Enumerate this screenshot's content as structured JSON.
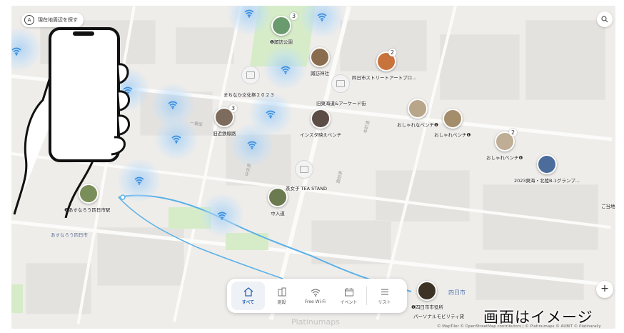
{
  "controls": {
    "locate_icon": "A",
    "locate_label": "現在地周辺を探す",
    "search_icon": "search-icon",
    "zoom_in": "+"
  },
  "pins": [
    {
      "label": "❶諏訪公園",
      "badge": "3",
      "color": "#6a9b6e"
    },
    {
      "label": "諏訪神社",
      "badge": "",
      "color": "#8a6d4f"
    },
    {
      "label": "四日市ストリートアートプロ...",
      "badge": "2",
      "color": "#c9733c"
    },
    {
      "label": "旧近鉄線路",
      "badge": "3",
      "color": "#7d6c5d"
    },
    {
      "label": "インスタ映えベンチ",
      "badge": "",
      "color": "#5b4d45"
    },
    {
      "label": "おしゃれなベンチ❶",
      "badge": "",
      "color": "#b8a58a"
    },
    {
      "label": "おしゃれベンチ❶",
      "badge": "",
      "color": "#a48d6b"
    },
    {
      "label": "おしゃれベンチ❹",
      "badge": "2",
      "color": "#bfae95"
    },
    {
      "label": "2023東海・北陸B-1グランプ...",
      "badge": "",
      "color": "#4c6d9b"
    },
    {
      "label": "中入道",
      "badge": "",
      "color": "#6b7a4f"
    },
    {
      "label": "❶あすなろう四日市駅",
      "badge": "",
      "color": "#7a8e5a"
    },
    {
      "label": "❶四日市市役所",
      "badge": "",
      "color": "#3c3226"
    }
  ],
  "gray_pins": [
    {
      "label": "まちなか文化祭２０２３"
    },
    {
      "label": "旧東海道&アーケード街"
    },
    {
      "label": "茶女子 TEA STAND"
    }
  ],
  "other_labels": {
    "personal_mobility": "パーソナルモビリティ貸",
    "station_area": "あすなろう四日市",
    "sign_text": "四日市",
    "right_edge": "ご当地物"
  },
  "nav": {
    "items": [
      {
        "label": "すべて",
        "icon": "home-icon",
        "active": true
      },
      {
        "label": "施設",
        "icon": "building-icon",
        "active": false
      },
      {
        "label": "Free Wi-Fi",
        "icon": "wifi-icon",
        "active": false
      },
      {
        "label": "イベント",
        "icon": "calendar-icon",
        "active": false
      },
      {
        "label": "リスト",
        "icon": "list-icon",
        "active": false
      }
    ]
  },
  "overlay_text": "画面はイメージ",
  "attribution": "© MapTiler © OpenStreetMap contributors | © Platinumaps © AUBIT © Platinarally",
  "watermark": "Platinumaps",
  "colors": {
    "accent": "#2b66b5",
    "route": "#5ab0e8",
    "park": "#d6ecc8"
  }
}
